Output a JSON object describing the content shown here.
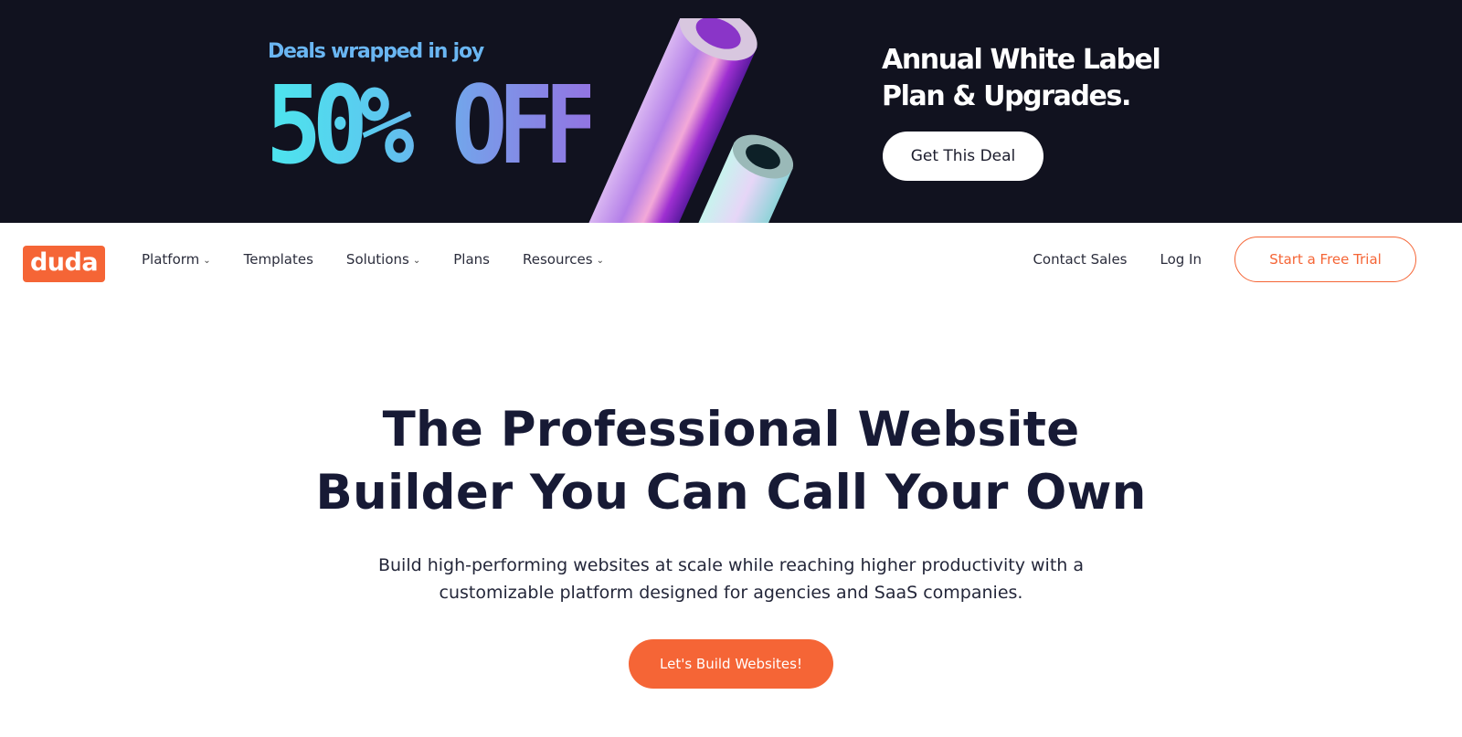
{
  "promo": {
    "kicker": "Deals wrapped in joy",
    "headline": "50% OFF",
    "offer_line1": "Annual White Label",
    "offer_line2": "Plan & Upgrades.",
    "cta_label": "Get This Deal",
    "graphic": "holographic-wrapping-paper-rolls"
  },
  "nav": {
    "logo_text": "duda",
    "links": [
      {
        "label": "Platform",
        "dropdown": true
      },
      {
        "label": "Templates",
        "dropdown": false
      },
      {
        "label": "Solutions",
        "dropdown": true
      },
      {
        "label": "Plans",
        "dropdown": false
      },
      {
        "label": "Resources",
        "dropdown": true
      }
    ],
    "dropdown_icon": "chevron-down-icon",
    "contact_sales": "Contact Sales",
    "log_in": "Log In",
    "trial_label": "Start a Free Trial"
  },
  "hero": {
    "title_line1": "The Professional Website",
    "title_line2": "Builder You Can Call Your Own",
    "subtitle_line1": "Build high-performing websites at scale while reaching higher productivity with a",
    "subtitle_line2": "customizable platform designed for agencies and SaaS companies.",
    "cta_label": "Let's Build Websites!"
  },
  "colors": {
    "brand": "#f56536",
    "banner_bg": "#11121f",
    "heading": "#171a35"
  }
}
